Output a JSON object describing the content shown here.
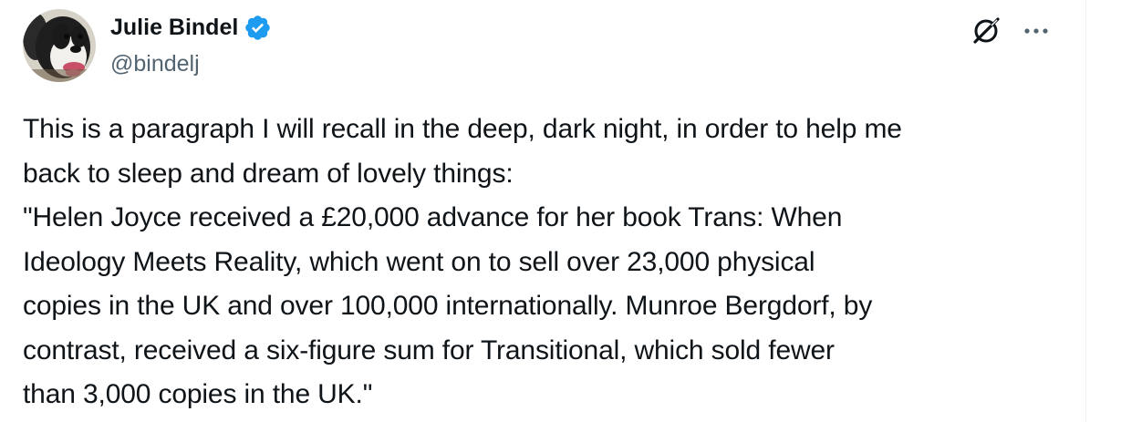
{
  "author": {
    "display_name": "Julie Bindel",
    "handle": "@bindelj",
    "verified": true,
    "verified_color": "#1d9bf0"
  },
  "icons": {
    "avatar": "dog-avatar-icon",
    "verified": "verified-badge-icon",
    "grok": "grok-icon",
    "more": "more-options-icon"
  },
  "tweet": {
    "lines": [
      "This is a paragraph I will recall in the deep, dark night, in order to help me",
      "back to sleep and dream of lovely things:",
      "\"Helen Joyce received a £20,000 advance for her book Trans: When",
      "Ideology Meets Reality, which went on to sell over 23,000 physical",
      "copies in the UK and over 100,000 internationally. Munroe Bergdorf, by",
      "contrast, received a six-figure sum for Transitional, which sold fewer",
      "than 3,000 copies in the UK.\""
    ]
  },
  "colors": {
    "text": "#0f1419",
    "secondary_text": "#536471",
    "divider": "#eff3f4"
  }
}
